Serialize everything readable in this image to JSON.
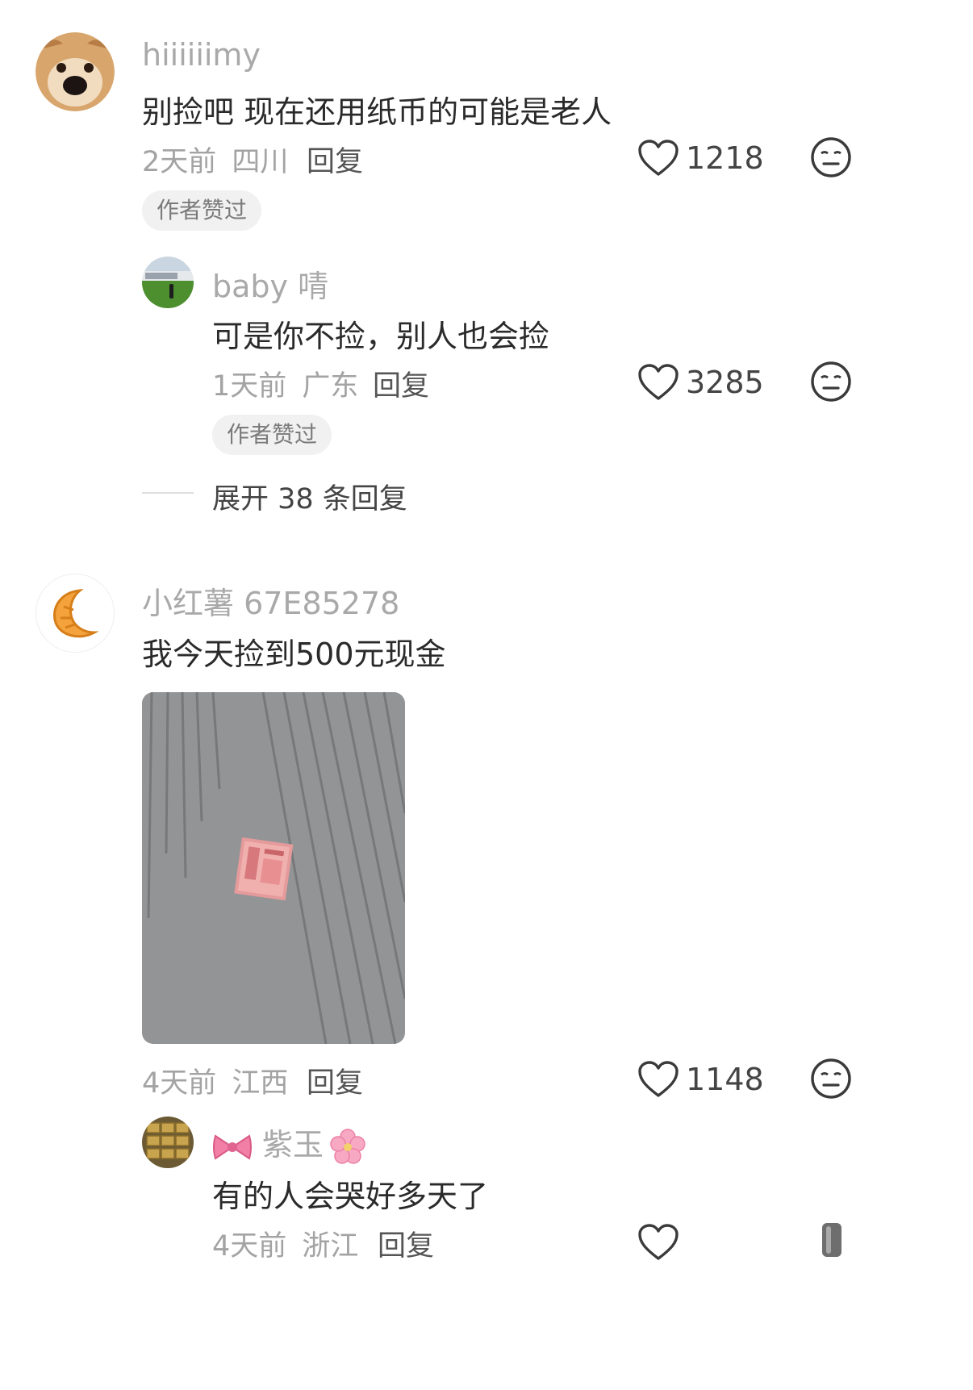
{
  "comments": [
    {
      "username": "hiiiiiimy",
      "text": "别捡吧 现在还用纸币的可能是老人",
      "time": "2天前",
      "location": "四川",
      "reply_label": "回复",
      "likes": "1218",
      "badge": "作者赞过",
      "avatar_icon": "dog-avatar",
      "replies": [
        {
          "username": "baby 啨",
          "text": "可是你不捡，别人也会捡",
          "time": "1天前",
          "location": "广东",
          "reply_label": "回复",
          "likes": "3285",
          "badge": "作者赞过",
          "avatar_icon": "landscape-avatar"
        }
      ],
      "expand_label": "展开 38 条回复"
    },
    {
      "username": "小红薯 67E85278",
      "text": "我今天捡到500元现金",
      "time": "4天前",
      "location": "江西",
      "reply_label": "回复",
      "likes": "1148",
      "avatar_icon": "croissant-avatar",
      "image_icon": "cash-on-ground-photo",
      "replies": [
        {
          "username": "紫玉",
          "text": "有的人会哭好多天了",
          "time": "4天前",
          "location": "浙江",
          "reply_label": "回复",
          "avatar_icon": "gold-bars-avatar"
        }
      ]
    }
  ],
  "icons": {
    "like": "heart-outline-icon",
    "more": "neutral-face-icon",
    "username_prefix": "bow-emoji",
    "username_suffix": "cherry-blossom-emoji"
  }
}
